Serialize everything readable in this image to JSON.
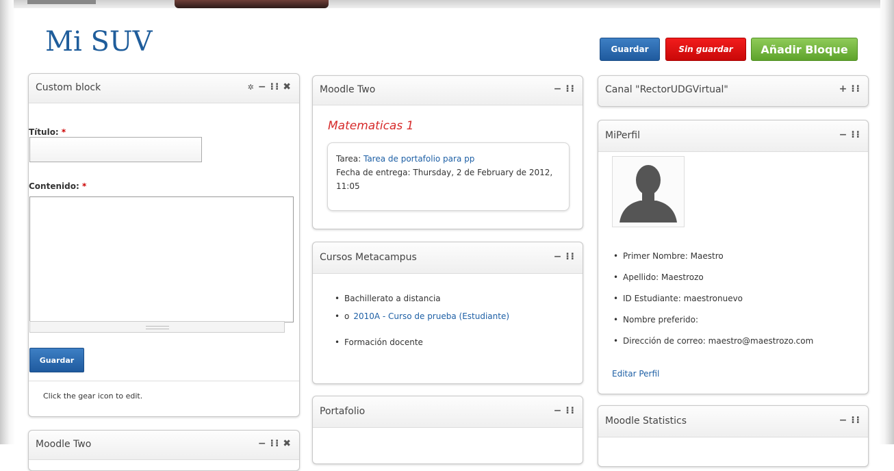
{
  "page": {
    "title": "Mi SUV"
  },
  "toolbar": {
    "save_label": "Guardar",
    "discard_label": "Sin guardar",
    "add_block_label": "Añadir Bloque"
  },
  "custom_block": {
    "title": "Custom block",
    "titulo_label": "Título:",
    "contenido_label": "Contenido:",
    "required_mark": "*",
    "titulo_value": "",
    "contenido_value": "",
    "save_label": "Guardar",
    "hint": "Click the gear icon to edit."
  },
  "moodle_two_block": {
    "title": "Moodle Two",
    "course": "Matematicas 1",
    "task_prefix": "Tarea:",
    "task_link": "Tarea de portafolio para pp",
    "due_text": "Fecha de entrega: Thursday, 2 de February de 2012, 11:05"
  },
  "metacampus_block": {
    "title": "Cursos Metacampus",
    "items": [
      {
        "label": "Bachillerato a distancia"
      },
      {
        "label": "2010A - Curso de prueba (Estudiante)",
        "nested_marker": "o"
      },
      {
        "label": "Formación docente"
      }
    ]
  },
  "portafolio_block": {
    "title": "Portafolio"
  },
  "moodle_two_block_2": {
    "title": "Moodle Two"
  },
  "canal_block": {
    "title": "Canal \"RectorUDGVirtual\""
  },
  "perfil_block": {
    "title": "MiPerfil",
    "fields": [
      "Primer Nombre: Maestro",
      "Apellido: Maestrozo",
      "ID Estudiante: maestronuevo",
      "Nombre preferido:",
      "Dirección de correo: maestro@maestrozo.com"
    ],
    "edit_link": "Editar Perfil"
  },
  "stats_block": {
    "title": "Moodle Statistics"
  },
  "icons": {
    "gear": "gear-icon",
    "minimize": "minimize-icon",
    "move": "move-icon",
    "close": "close-icon",
    "add": "add-icon"
  },
  "colors": {
    "title": "#1f5d9b",
    "save": "#2a6db5",
    "discard": "#e01010",
    "add": "#76b843",
    "course": "#d62b2b",
    "link": "#1d5fa5"
  }
}
